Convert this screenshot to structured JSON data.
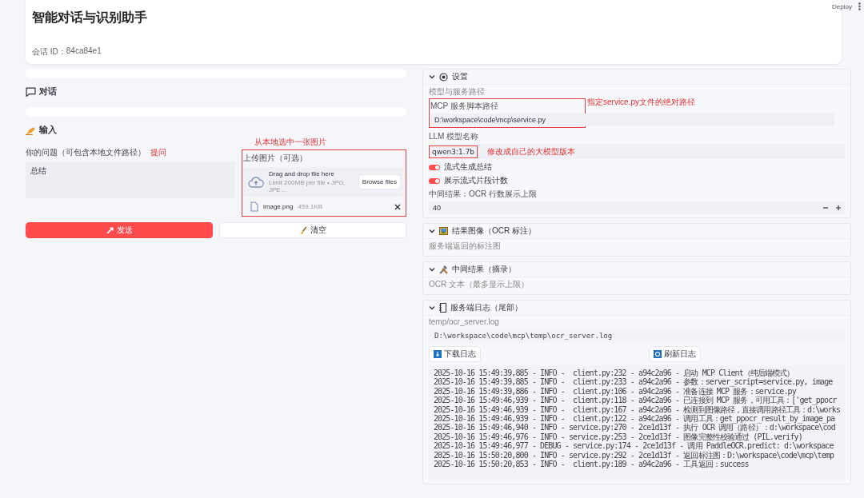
{
  "toolbar": {
    "deploy": "Deploy"
  },
  "header": {
    "title": "智能对话与识别助手",
    "session_label": "会话 ID：",
    "session_id": "84ca84e1"
  },
  "chat": {
    "title": "对话"
  },
  "input": {
    "title": "输入",
    "question_label": "你的问题（可包含本地文件路径）",
    "question_note": "提问",
    "question_value": "总结",
    "upload_note": "从本地选中一张图片",
    "upload_label": "上传图片（可选）",
    "drop_title": "Drag and drop file here",
    "drop_hint": "Limit 200MB per file • JPG, JPE…",
    "browse": "Browse files",
    "file": {
      "name": "image.png",
      "size": "459.1KB"
    },
    "send": "发送",
    "clear": "清空"
  },
  "settings": {
    "title": "设置",
    "expanded": true,
    "subtitle": "模型与服务路径",
    "script_label": "MCP 服务脚本路径",
    "script_note": "指定service.py文件的绝对路径",
    "script_value": "D:\\workspace\\code\\mcp\\service.py",
    "model_label": "LLM 模型名称",
    "model_note": "修改成自己的大模型版本",
    "model_value": "qwen3:1.7b",
    "toggles": [
      {
        "label": "流式生成总结",
        "on": true
      },
      {
        "label": "展示流式片段计数",
        "on": true
      }
    ],
    "limit_label": "中间结果：OCR 行数展示上限",
    "limit_value": "40"
  },
  "result_image": {
    "title": "结果图像（OCR 标注）",
    "expanded": true,
    "caption": "服务端返回的标注图"
  },
  "intermediate": {
    "title": "中间结果（摘录）",
    "expanded": true,
    "caption": "OCR 文本（最多显示上限）"
  },
  "log": {
    "title": "服务端日志（尾部）",
    "expanded": true,
    "caption": "temp/ocr_server.log",
    "path": "D:\\workspace\\code\\mcp\\temp\\ocr_server.log",
    "download": "下载日志",
    "refresh": "刷新日志",
    "lines": [
      "2025-10-16 15:49:39,885 - INFO -  client.py:232 - a94c2a96 - 启动 MCP Client（纯后端模式）",
      "2025-10-16 15:49:39,885 - INFO -  client.py:233 - a94c2a96 - 参数：server_script=service.py, image",
      "2025-10-16 15:49:39,886 - INFO -  client.py:106 - a94c2a96 - 准备连接 MCP 服务：service.py",
      "2025-10-16 15:49:46,939 - INFO -  client.py:118 - a94c2a96 - 已连接到 MCP 服务，可用工具：['get_ppocr",
      "2025-10-16 15:49:46,939 - INFO -  client.py:167 - a94c2a96 - 检测到图像路径，直接调用路径工具：d:\\works",
      "2025-10-16 15:49:46,939 - INFO -  client.py:122 - a94c2a96 - 调用工具：get_ppocr_result_by_image_pa",
      "2025-10-16 15:49:46,940 - INFO - service.py:270 - 2ce1d13f - 执行 OCR 调用（路径）：d:\\workspace\\cod",
      "2025-10-16 15:49:46,976 - INFO - service.py:253 - 2ce1d13f - 图像完整性校验通过 (PIL.verify)",
      "2025-10-16 15:49:46,977 - DEBUG - service.py:174 - 2ce1d13f - 调用 PaddleOCR.predict: d:\\workspace",
      "2025-10-16 15:50:20,800 - INFO - service.py:292 - 2ce1d13f - 返回标注图：D:\\workspace\\code\\mcp\\temp",
      "2025-10-16 15:50:20,853 - INFO -  client.py:189 - a94c2a96 - 工具返回：success"
    ]
  }
}
